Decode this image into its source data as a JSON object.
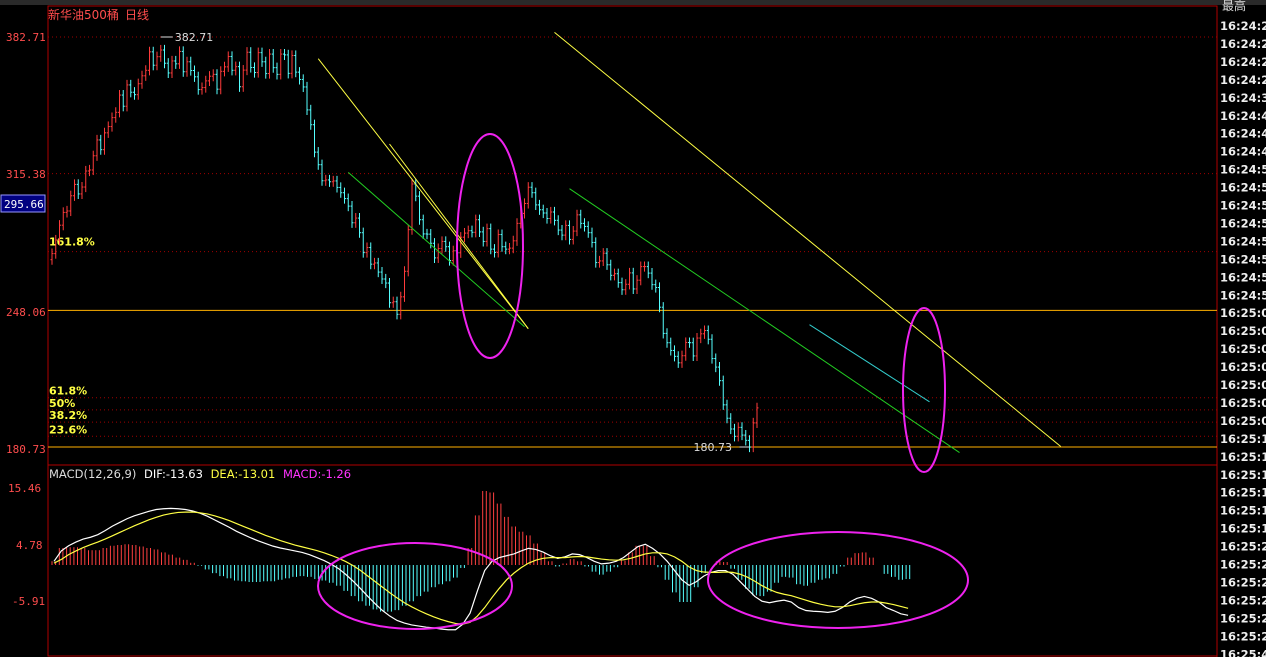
{
  "header": {
    "security_title": "新华油500桶",
    "period": "日线",
    "top_right_label": "最高"
  },
  "price_panel": {
    "y_ticks": [
      "382.71",
      "315.38",
      "248.06",
      "180.73"
    ],
    "current_price": "295.66",
    "high_marker": "382.71",
    "low_marker": "180.73",
    "fib_labels": [
      {
        "label": "161.8%",
        "value": 277
      },
      {
        "label": "61.8%",
        "value": 205
      },
      {
        "label": "50%",
        "value": 199
      },
      {
        "label": "38.2%",
        "value": 193
      },
      {
        "label": "23.6%",
        "value": 186
      }
    ],
    "colors": {
      "up": "#ff3b3b",
      "down": "#55ffff",
      "support": "#ffb000",
      "trend": "#ffff44",
      "channel": "#22cc22",
      "highlight": "#ee22ee"
    }
  },
  "macd_panel": {
    "legend": {
      "name": "MACD(12,26,9)",
      "dif": "DIF:-13.63",
      "dea": "DEA:-13.01",
      "macd": "MACD:-1.26"
    },
    "y_ticks": [
      "15.46",
      "4.78",
      "-5.91"
    ]
  },
  "time_axis": {
    "labels": [
      "16:24:2",
      "16:24:2",
      "16:24:2",
      "16:24:2",
      "16:24:3",
      "16:24:4",
      "16:24:4",
      "16:24:4",
      "16:24:5",
      "16:24:5",
      "16:24:5",
      "16:24:5",
      "16:24:5",
      "16:24:5",
      "16:24:5",
      "16:24:5",
      "16:25:0",
      "16:25:0",
      "16:25:0",
      "16:25:0",
      "16:25:0",
      "16:25:0",
      "16:25:0",
      "16:25:1",
      "16:25:1",
      "16:25:1",
      "16:25:1",
      "16:25:1",
      "16:25:1",
      "16:25:2",
      "16:25:2",
      "16:25:2",
      "16:25:2",
      "16:25:2",
      "16:25:2",
      "16:25:4"
    ]
  },
  "chart_data": [
    {
      "type": "bar",
      "title": "新华油500桶 日线",
      "ylim": [
        180.73,
        382.71
      ],
      "x": [
        1,
        2,
        3,
        4,
        5,
        6,
        7,
        8,
        9,
        10,
        11,
        12,
        13,
        14,
        15,
        16,
        17,
        18,
        19,
        20,
        21,
        22,
        23,
        24,
        25,
        26,
        27,
        28,
        29,
        30,
        31,
        32,
        33,
        34,
        35,
        36,
        37,
        38,
        39,
        40,
        41,
        42,
        43,
        44,
        45,
        46,
        47,
        48,
        49,
        50,
        51,
        52,
        53,
        54,
        55,
        56,
        57,
        58,
        59,
        60,
        61,
        62,
        63,
        64,
        65,
        66,
        67,
        68,
        69,
        70,
        71,
        72,
        73,
        74,
        75,
        76,
        77,
        78,
        79,
        80,
        81,
        82,
        83,
        84,
        85,
        86,
        87,
        88,
        89,
        90,
        91,
        92,
        93,
        94,
        95,
        96,
        97,
        98,
        99,
        100,
        101,
        102,
        103,
        104,
        105,
        106,
        107,
        108,
        109,
        110,
        111,
        112,
        113,
        114,
        115,
        116,
        117,
        118,
        119,
        120,
        121,
        122,
        123,
        124,
        125,
        126,
        127,
        128,
        129,
        130,
        131,
        132,
        133,
        134,
        135,
        136,
        137,
        138,
        139,
        140,
        141,
        142,
        143,
        144,
        145,
        146,
        147,
        148,
        149,
        150,
        151,
        152,
        153,
        154,
        155,
        156,
        157,
        158,
        159,
        160,
        161,
        162,
        163,
        164,
        165,
        166,
        167,
        168,
        169,
        170,
        171,
        172,
        173,
        174,
        175,
        176,
        177,
        178,
        179,
        180,
        181,
        182,
        183,
        184,
        185,
        186,
        187,
        188,
        189,
        190,
        191,
        192,
        193,
        194,
        195,
        196,
        197,
        198,
        199,
        200,
        201,
        202,
        203,
        204,
        205,
        206,
        207,
        208,
        209,
        210,
        211,
        212,
        213,
        214,
        215,
        216,
        217,
        218,
        219,
        220,
        221,
        222,
        223,
        224,
        225,
        226,
        227,
        228,
        229
      ],
      "close": [
        276.0,
        282.7,
        290.0,
        296.3,
        297.0,
        304.5,
        310.1,
        305.4,
        308.8,
        316.7,
        317.2,
        324.2,
        332.0,
        327.2,
        335.5,
        338.6,
        343.0,
        345.6,
        354.1,
        348.6,
        359.1,
        355.5,
        354.3,
        359.7,
        363.6,
        366.3,
        375.4,
        368.8,
        373.0,
        376.3,
        369.8,
        365.0,
        370.9,
        369.5,
        375.6,
        365.6,
        370.5,
        366.2,
        363.1,
        356.8,
        357.8,
        361.1,
        363.4,
        364.3,
        357.0,
        365.8,
        368.0,
        373.1,
        366.3,
        368.1,
        358.2,
        366.4,
        375.2,
        367.7,
        365.2,
        375.0,
        370.5,
        364.7,
        374.3,
        367.6,
        364.3,
        374.3,
        373.9,
        364.8,
        373.6,
        365.4,
        361.8,
        358.1,
        346.8,
        339.5,
        326.0,
        319.8,
        311.9,
        312.3,
        311.4,
        311.8,
        308.6,
        306.0,
        303.1,
        299.4,
        291.2,
        293.5,
        286.3,
        276.5,
        279.0,
        270.8,
        271.4,
        266.9,
        263.5,
        261.5,
        251.8,
        252.3,
        246.1,
        254.7,
        267.3,
        287.8,
        310.3,
        304.3,
        292.7,
        285.7,
        285.6,
        281.1,
        273.9,
        278.5,
        282.0,
        279.4,
        272.6,
        277.4,
        276.4,
        284.1,
        286.1,
        287.3,
        286.5,
        292.7,
        286.7,
        282.0,
        288.3,
        278.2,
        276.6,
        285.4,
        279.4,
        278.2,
        278.7,
        282.3,
        290.9,
        295.8,
        300.7,
        308.7,
        306.0,
        300.0,
        297.6,
        296.0,
        293.3,
        296.5,
        292.4,
        287.6,
        285.1,
        289.9,
        283.0,
        287.1,
        295.1,
        290.9,
        289.4,
        286.3,
        281.5,
        271.6,
        272.4,
        276.2,
        270.5,
        265.3,
        266.1,
        261.7,
        258.2,
        260.9,
        266.5,
        258.6,
        262.9,
        269.6,
        269.6,
        266.4,
        260.7,
        259.3,
        249.6,
        236.7,
        232.1,
        228.3,
        225.4,
        222.2,
        225.7,
        232.2,
        232.1,
        225.6,
        234.4,
        236.5,
        238.1,
        233.8,
        224.3,
        220.1,
        213.4,
        201.5,
        194.9,
        189.6,
        186.0,
        190.4,
        186.6,
        184.0,
        180.7,
        192.6,
        200.0
      ],
      "series": [
        {
          "name": "DIF",
          "values": [
            1.0,
            3.8,
            5.2,
            6.2,
            7.0,
            7.5,
            8.2,
            9.3,
            10.5,
            11.5,
            12.5,
            13.3,
            13.9,
            14.5,
            15.0,
            15.2,
            15.3,
            15.2,
            15.0,
            14.6,
            14.0,
            13.2,
            12.2,
            11.2,
            10.2,
            9.1,
            8.2,
            7.3,
            6.5,
            5.8,
            5.1,
            4.6,
            4.2,
            3.8,
            3.4,
            2.8,
            2.0,
            1.2,
            0.2,
            -1.0,
            -2.6,
            -4.4,
            -6.4,
            -8.5,
            -10.5,
            -12.3,
            -13.8,
            -15.0,
            -15.7,
            -16.2,
            -16.5,
            -16.8,
            -17.0,
            -17.3,
            -17.5,
            -17.5,
            -16.0,
            -13.0,
            -7.0,
            -1.5,
            1.0,
            2.0,
            2.5,
            3.0,
            3.8,
            4.5,
            4.2,
            3.5,
            2.5,
            1.8,
            2.2,
            3.0,
            2.8,
            2.0,
            1.0,
            0.3,
            0.5,
            1.0,
            2.0,
            3.5,
            5.0,
            5.6,
            4.5,
            3.0,
            1.0,
            -1.5,
            -4.0,
            -5.5,
            -4.5,
            -3.0,
            -2.0,
            -1.5,
            -1.5,
            -2.5,
            -4.5,
            -6.5,
            -8.5,
            -9.8,
            -10.2,
            -9.8,
            -9.5,
            -10.0,
            -11.5,
            -12.3,
            -12.5,
            -12.6,
            -12.8,
            -12.5,
            -11.5,
            -10.0,
            -9.0,
            -8.5,
            -9.0,
            -10.0,
            -11.5,
            -12.3,
            -13.2,
            -13.6
          ]
        },
        {
          "name": "DEA",
          "values": [
            0.5,
            1.5,
            2.8,
            3.8,
            4.7,
            5.5,
            6.2,
            7.0,
            7.9,
            8.8,
            9.7,
            10.6,
            11.4,
            12.2,
            12.9,
            13.5,
            13.9,
            14.2,
            14.3,
            14.3,
            14.1,
            13.8,
            13.3,
            12.7,
            12.0,
            11.2,
            10.4,
            9.6,
            8.8,
            8.0,
            7.3,
            6.6,
            6.0,
            5.4,
            4.9,
            4.4,
            3.9,
            3.3,
            2.6,
            1.8,
            0.9,
            -0.2,
            -1.5,
            -3.0,
            -4.5,
            -6.0,
            -7.5,
            -8.9,
            -10.2,
            -11.3,
            -12.3,
            -13.2,
            -14.0,
            -14.7,
            -15.3,
            -15.8,
            -16.0,
            -15.5,
            -13.8,
            -11.5,
            -8.8,
            -6.3,
            -4.0,
            -2.2,
            -0.7,
            0.5,
            1.3,
            1.8,
            2.0,
            2.0,
            2.0,
            2.2,
            2.3,
            2.2,
            1.9,
            1.6,
            1.4,
            1.3,
            1.4,
            1.8,
            2.4,
            3.0,
            3.3,
            3.3,
            3.0,
            2.2,
            1.0,
            -0.5,
            -1.5,
            -1.9,
            -2.0,
            -2.0,
            -1.9,
            -2.0,
            -2.5,
            -3.3,
            -4.4,
            -5.6,
            -6.6,
            -7.4,
            -7.9,
            -8.3,
            -8.9,
            -9.5,
            -10.1,
            -10.6,
            -11.0,
            -11.3,
            -11.3,
            -11.0,
            -10.6,
            -10.2,
            -10.0,
            -10.0,
            -10.3,
            -10.7,
            -11.2,
            -11.7
          ]
        }
      ],
      "xlabel": "",
      "ylabel": ""
    },
    {
      "type": "bar",
      "title": "MACD(12,26,9)",
      "ylim": [
        -20,
        19
      ],
      "series": [
        {
          "name": "MACD",
          "values": [
            1.0,
            4.6,
            4.8,
            4.8,
            4.6,
            4.0,
            4.0,
            4.6,
            5.2,
            5.4,
            5.6,
            5.4,
            5.0,
            4.6,
            4.2,
            3.4,
            2.8,
            2.0,
            1.4,
            0.6,
            -0.2,
            -1.2,
            -2.2,
            -3.0,
            -3.6,
            -4.2,
            -4.4,
            -4.6,
            -4.6,
            -4.4,
            -4.4,
            -4.0,
            -3.6,
            -3.2,
            -3.0,
            -3.2,
            -3.8,
            -4.2,
            -4.8,
            -5.6,
            -7.0,
            -8.4,
            -9.8,
            -11.0,
            -12.0,
            -12.6,
            -12.6,
            -12.2,
            -11.0,
            -9.8,
            -8.4,
            -7.2,
            -6.0,
            -5.2,
            -4.4,
            -3.4,
            -0.8,
            4.6,
            13.4,
            20.0,
            19.6,
            16.6,
            13.0,
            10.4,
            9.0,
            8.0,
            5.8,
            3.4,
            1.0,
            -0.4,
            0.4,
            1.6,
            1.0,
            -0.4,
            -1.8,
            -2.6,
            -1.8,
            -0.6,
            1.2,
            3.4,
            5.2,
            5.2,
            2.4,
            -0.6,
            -4.0,
            -7.4,
            -10.0,
            -10.0,
            -6.0,
            -2.2,
            0.0,
            1.0,
            0.8,
            -1.0,
            -4.0,
            -6.4,
            -8.2,
            -8.4,
            -7.2,
            -4.8,
            -3.2,
            -3.4,
            -5.2,
            -5.6,
            -4.8,
            -4.0,
            -3.6,
            -2.4,
            -0.4,
            2.0,
            3.2,
            3.4,
            2.0,
            0.0,
            -2.4,
            -3.2,
            -4.0,
            -3.8
          ]
        }
      ],
      "xlabel": "",
      "ylabel": ""
    }
  ]
}
